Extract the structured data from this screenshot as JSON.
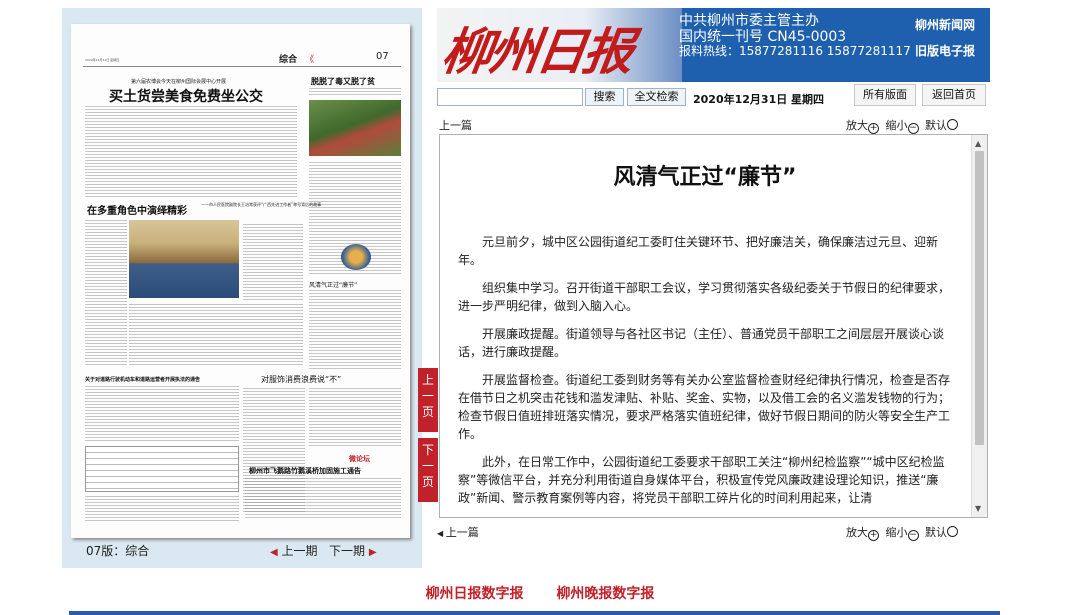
{
  "header": {
    "logo_text": "柳州日报",
    "info_line1": "中共柳州市委主管主办",
    "info_line2": "国内统一刊号 CN45-0003",
    "info_line3": "报料热线：15877281116  15877281117",
    "link_news_net": "柳州新闻网",
    "link_old_edition": "旧版电子报"
  },
  "search": {
    "placeholder": "",
    "search_label": "搜索",
    "fulltext_label": "全文检索",
    "date_text": "2020年12月31日 星期四"
  },
  "top_buttons": {
    "all_layouts": "所有版面",
    "back_home": "返回首页"
  },
  "article_nav": {
    "prev_article": "上一篇",
    "zoom_in": "放大",
    "zoom_out": "缩小",
    "zoom_default": "默认"
  },
  "article": {
    "title": "风清气正过“廉节”",
    "paragraphs": [
      "元旦前夕，城中区公园街道纪工委盯住关键环节、把好廉洁关，确保廉洁过元旦、迎新年。",
      "组织集中学习。召开街道干部职工会议，学习贯彻落实各级纪委关于节假日的纪律要求，进一步严明纪律，做到入脑入心。",
      "开展廉政提醒。街道领导与各社区书记（主任）、普通党员干部职工之间层层开展谈心谈话，进行廉政提醒。",
      "开展监督检查。街道纪工委到财务等有关办公室监督检查财经纪律执行情况，检查是否存在借节日之机突击花钱和滥发津贴、补贴、奖金、实物，以及借工会的名义滥发钱物的行为；检查节假日值班排班落实情况，要求严格落实值班纪律，做好节假日期间的防火等安全生产工作。",
      "此外，在日常工作中，公园街道纪工委要求干部职工关注“柳州纪检监察”“城中区纪检监察”等微信平台，并充分利用街道自身媒体平台，积极宣传党风廉政建设理论知识，推送“廉政”新闻、警示教育案例等内容，将党员干部职工碎片化的时间利用起来，让清"
    ]
  },
  "newspaper": {
    "section": "综合",
    "page_no": "07",
    "headline1_sub": "第六届农博会今天在柳州国际会展中心开展",
    "headline1": "买土货尝美食免费坐公交",
    "headline2": "在多重角色中演绎精彩",
    "headline2_sub": "——市人民医院副院长王冶常获评“广西先进工作者”称号背后的故事",
    "headline3": "脱脱了毒又脱了贫",
    "headline4": "风清气正过“廉节”",
    "headline5": "对服饰消费浪费说“不”",
    "headline6": "关于对道路行驶机动车和道路运营者开展执法的通告",
    "headline7": "柳州市飞鹅路竹鹅溪桥加固施工通告",
    "forum_label": "微论坛"
  },
  "side_tabs": {
    "prev_page": "上一页",
    "next_page": "下一页"
  },
  "left_footer": {
    "edition": "07版：综合",
    "prev_issue": "上一期",
    "next_issue": "下一期"
  },
  "bottom_links": {
    "daily": "柳州日报数字报",
    "evening": "柳州晚报数字报"
  },
  "colors": {
    "brand_blue": "#1e5fae",
    "brand_red": "#c0212a"
  }
}
